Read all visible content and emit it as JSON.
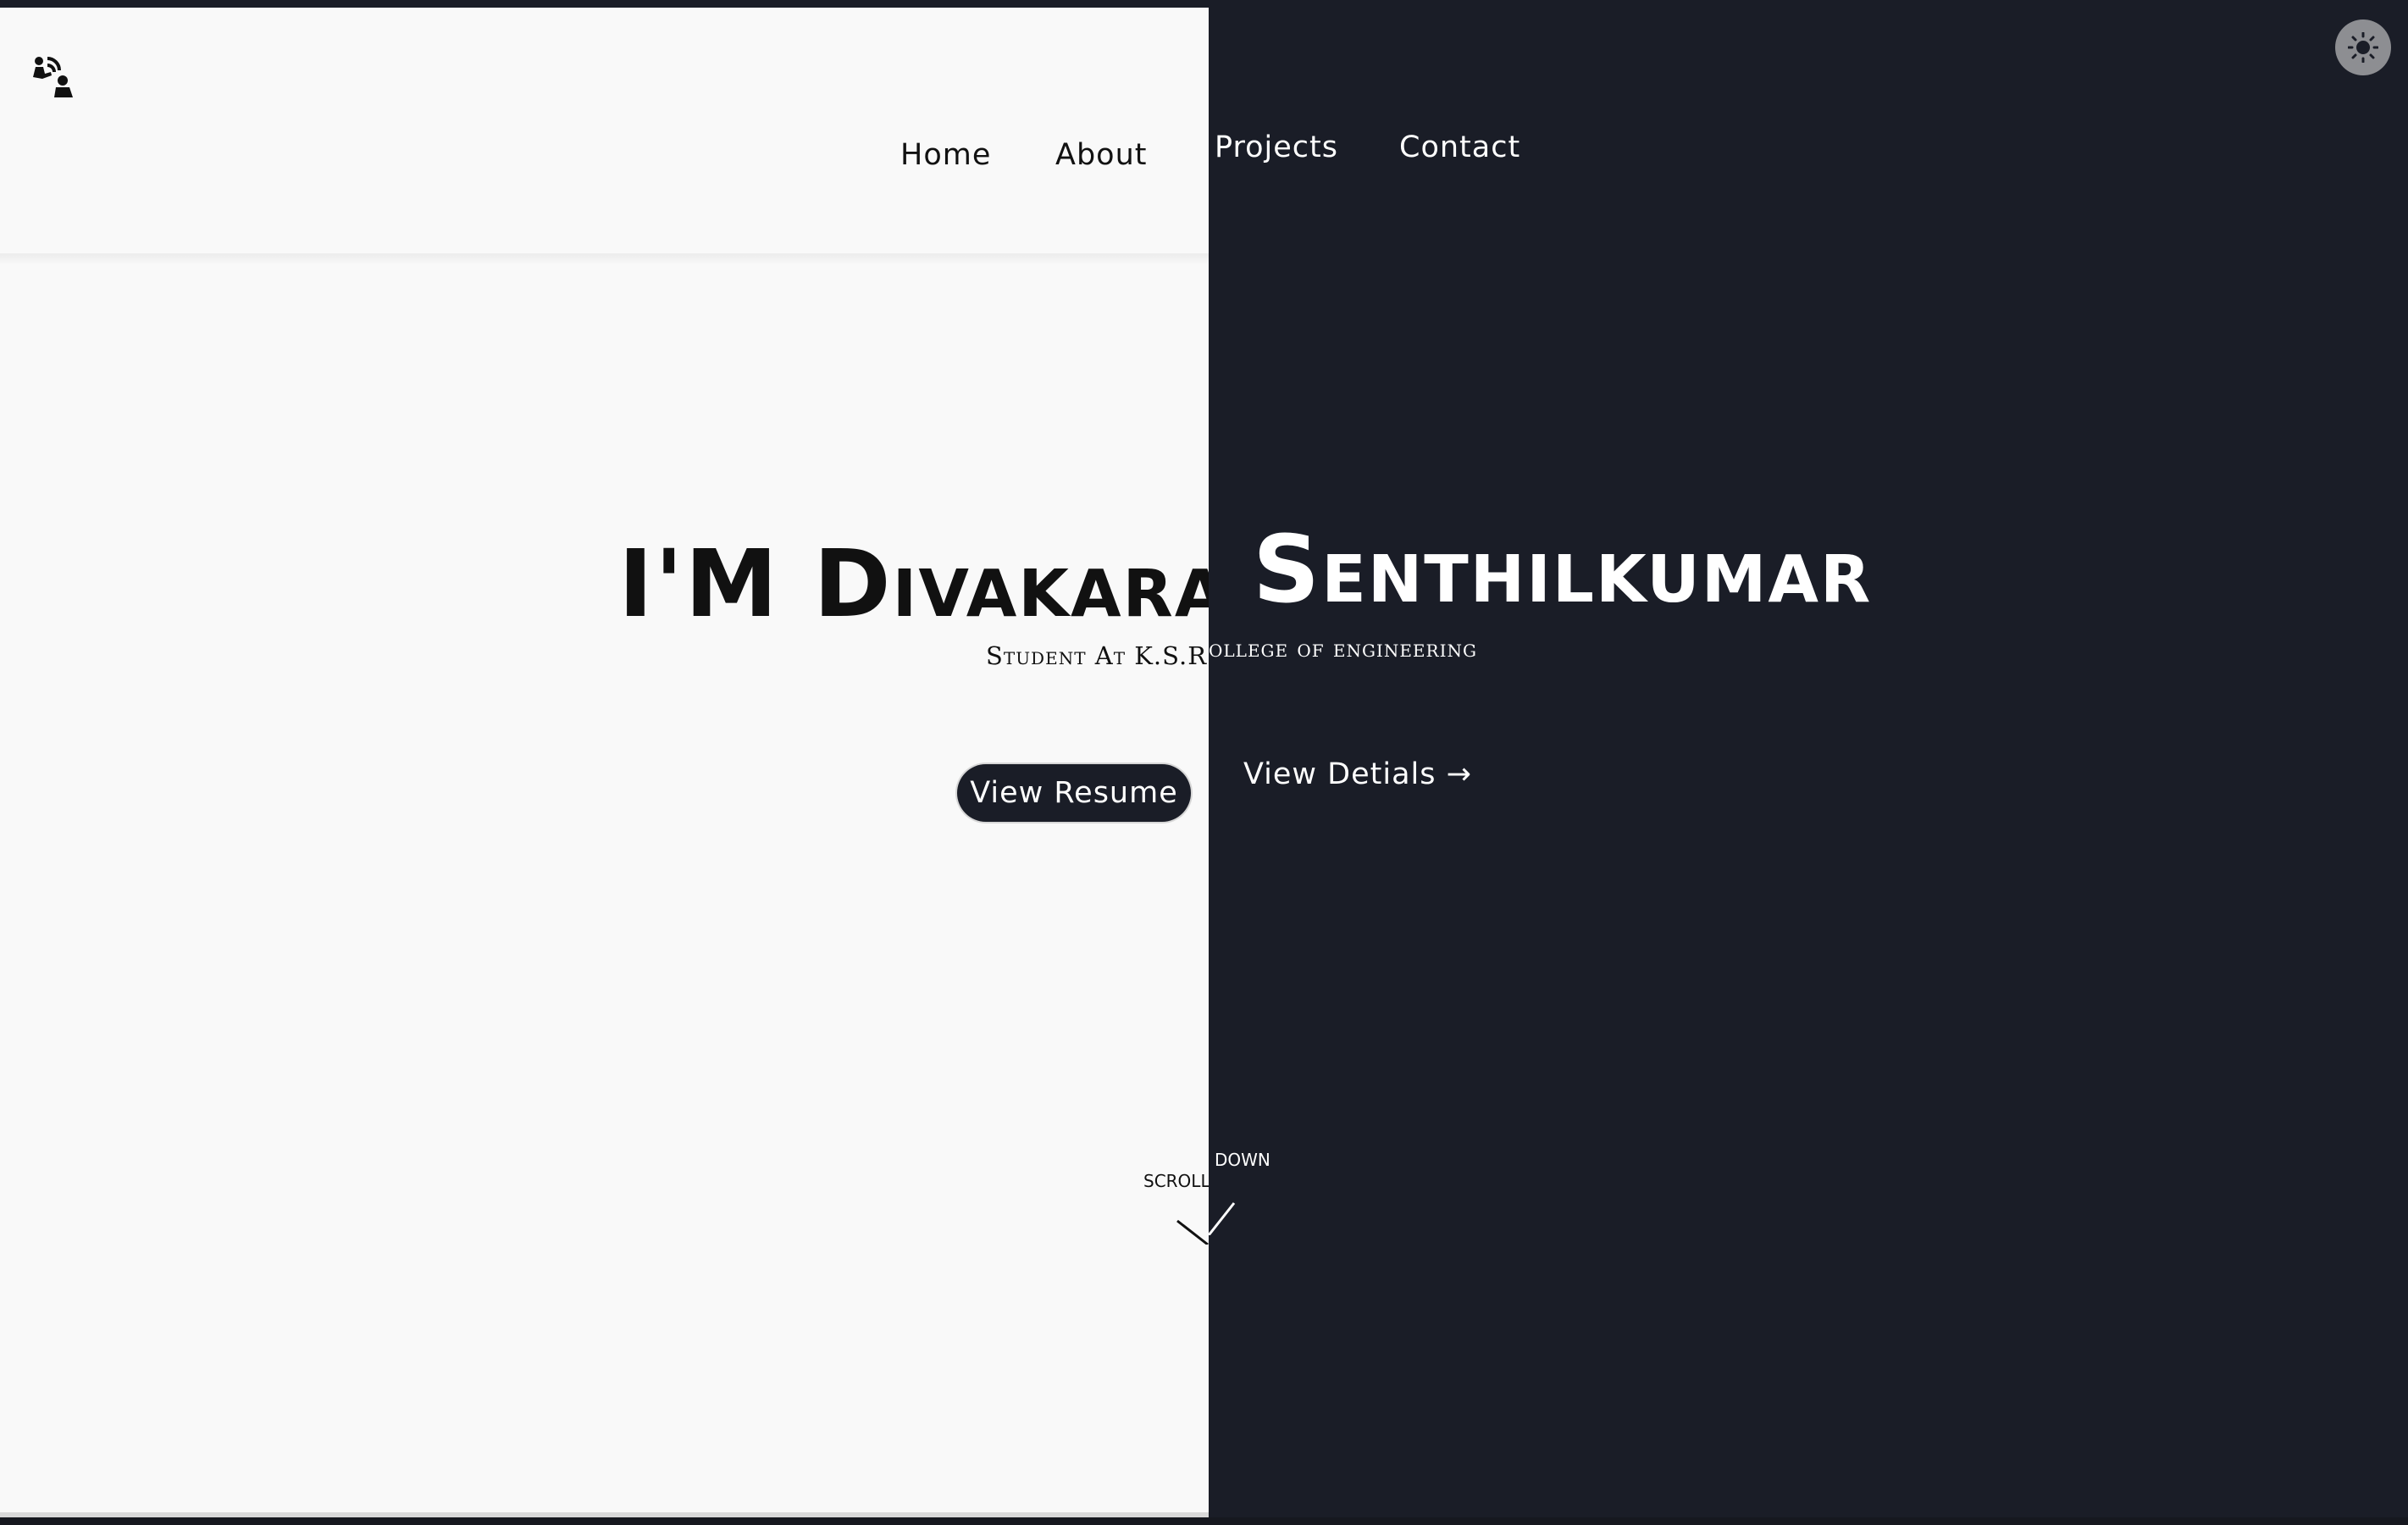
{
  "header": {
    "logo_icon": "person-signal-icon",
    "nav": {
      "home": "Home",
      "about": "About",
      "projects": "Projects",
      "contact": "Contact"
    },
    "theme_toggle_icon": "sun-icon"
  },
  "hero": {
    "title_left": "I'M Divakaran_",
    "title_right": "Senthilkumar",
    "subtitle_left": "Student At K.S.R. c",
    "subtitle_right": "ollege of engineering",
    "resume_button": "View Resume",
    "details_link": "View Detials",
    "details_arrow": "→"
  },
  "scroll": {
    "left": "SCROLL",
    "right": "DOWN"
  },
  "colors": {
    "light_bg": "#f9f9f9",
    "dark_bg": "#1a1d27",
    "toggle_bg": "#8d8e92"
  }
}
